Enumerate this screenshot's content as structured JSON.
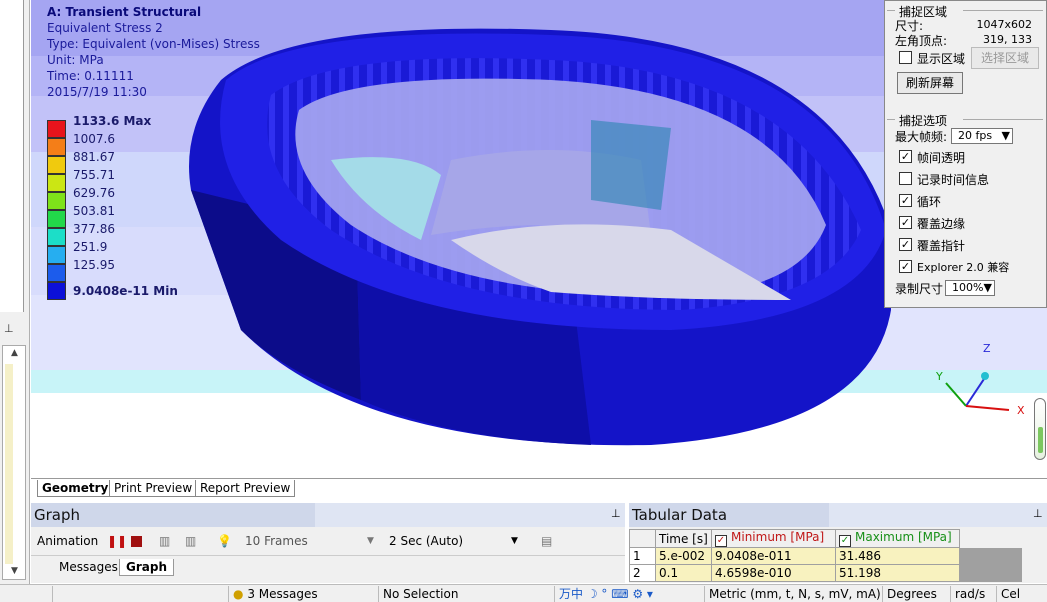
{
  "viewport": {
    "info": {
      "title": "A: Transient Structural",
      "result": "Equivalent Stress 2",
      "type": "Type: Equivalent (von-Mises) Stress",
      "unit": "Unit: MPa",
      "time": "Time: 0.11111",
      "date": "2015/7/19 11:30"
    },
    "legend": [
      {
        "label": "1133.6 Max",
        "color": "#e8141c",
        "bold": true
      },
      {
        "label": "1007.6",
        "color": "#f47e18"
      },
      {
        "label": "881.67",
        "color": "#f0ca0e"
      },
      {
        "label": "755.71",
        "color": "#cbe614"
      },
      {
        "label": "629.76",
        "color": "#7ee21a"
      },
      {
        "label": "503.81",
        "color": "#22d84a"
      },
      {
        "label": "377.86",
        "color": "#1cdec8"
      },
      {
        "label": "251.9",
        "color": "#26aef0"
      },
      {
        "label": "125.95",
        "color": "#1c5cec"
      },
      {
        "label": "9.0408e-11 Min",
        "color": "#0c10d8",
        "bold": true
      }
    ],
    "triad": {
      "z": "Z",
      "y": "Y",
      "x": "X"
    },
    "tabs": [
      "Geometry",
      "Print Preview",
      "Report Preview"
    ]
  },
  "capture": {
    "area_group": "捕捉区域",
    "size_label": "尺寸:",
    "size_value": "1047x602",
    "corner_label": "左角顶点:",
    "corner_value": "319, 133",
    "show_area": "显示区域",
    "select_area": "选择区域",
    "refresh": "刷新屏幕",
    "options_group": "捕捉选项",
    "fps_label": "最大帧频:",
    "fps_value": "20 fps",
    "options": [
      {
        "label": "帧间透明",
        "checked": true
      },
      {
        "label": "记录时间信息",
        "checked": false
      },
      {
        "label": "循环",
        "checked": true
      },
      {
        "label": "覆盖边缘",
        "checked": true
      },
      {
        "label": "覆盖指针",
        "checked": true
      },
      {
        "label": "Explorer 2.0 兼容",
        "checked": true
      }
    ],
    "rec_size_label": "录制尺寸",
    "rec_size_value": "100%"
  },
  "graph": {
    "title": "Graph",
    "animation_label": "Animation",
    "frames": "10 Frames",
    "duration": "2 Sec (Auto)",
    "tabs": [
      "Messages",
      "Graph"
    ]
  },
  "tabular": {
    "title": "Tabular Data",
    "headers": [
      "Time [s]",
      "Minimum [MPa]",
      "Maximum [MPa]"
    ],
    "rows": [
      {
        "n": "1",
        "time": "5.e-002",
        "min": "9.0408e-011",
        "max": "31.486"
      },
      {
        "n": "2",
        "time": "0.1",
        "min": "4.6598e-010",
        "max": "51.198"
      }
    ]
  },
  "status": {
    "messages": "3 Messages",
    "selection": "No Selection",
    "ime": "万中",
    "units": "Metric (mm, t, N, s, mV, mA)",
    "angle": "Degrees",
    "rate": "rad/s",
    "temp": "Cel"
  }
}
